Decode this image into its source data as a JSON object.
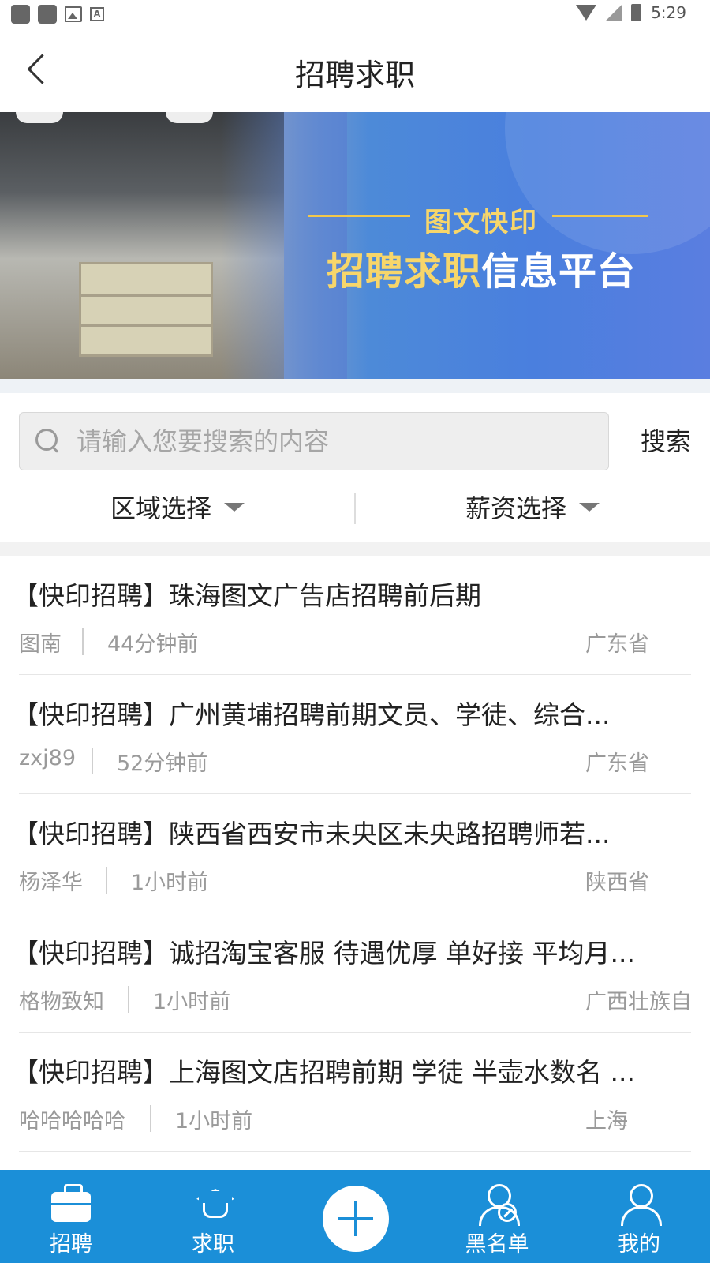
{
  "status_bar": {
    "time": "5:29"
  },
  "header": {
    "title": "招聘求职"
  },
  "banner": {
    "subtitle": "图文快印",
    "title_highlight": "招聘求职",
    "title_rest": "信息平台"
  },
  "search": {
    "placeholder": "请输入您要搜索的内容",
    "button_label": "搜索"
  },
  "filters": {
    "region": "区域选择",
    "salary": "薪资选择"
  },
  "listings": [
    {
      "title": "【快印招聘】珠海图文广告店招聘前后期",
      "author": "图南",
      "time": "44分钟前",
      "region": "广东省"
    },
    {
      "title": "【快印招聘】广州黄埔招聘前期文员、学徒、综合...",
      "author": "zxj89",
      "time": "52分钟前",
      "region": "广东省"
    },
    {
      "title": "【快印招聘】陕西省西安市未央区未央路招聘师若...",
      "author": "杨泽华",
      "time": "1小时前",
      "region": "陕西省"
    },
    {
      "title": "【快印招聘】诚招淘宝客服 待遇优厚 单好接 平均月...",
      "author": "格物致知",
      "time": "1小时前",
      "region": "广西壮族自"
    },
    {
      "title": "【快印招聘】上海图文店招聘前期 学徒 半壶水数名 ...",
      "author": "哈哈哈哈哈",
      "time": "1小时前",
      "region": "上海"
    }
  ],
  "bottom_nav": {
    "recruit": "招聘",
    "jobseek": "求职",
    "blacklist": "黑名单",
    "mine": "我的"
  },
  "colors": {
    "accent": "#1b8fd8",
    "banner_gold": "#f7d66a"
  }
}
